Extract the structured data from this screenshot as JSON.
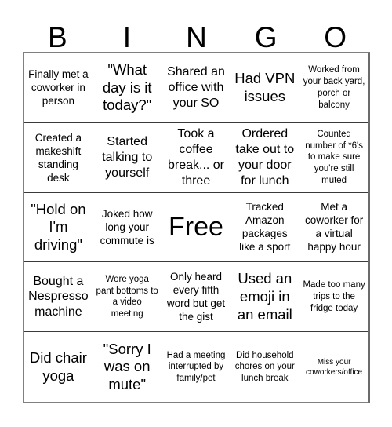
{
  "card": {
    "header_letters": [
      "B",
      "I",
      "N",
      "G",
      "O"
    ],
    "rows": [
      [
        {
          "text": "Finally met a coworker in person",
          "size": "md"
        },
        {
          "text": "\"What day is it today?\"",
          "size": "xl"
        },
        {
          "text": "Shared an office with your SO",
          "size": "lg"
        },
        {
          "text": "Had VPN issues",
          "size": "xl"
        },
        {
          "text": "Worked from your back yard, porch or balcony",
          "size": "sm"
        }
      ],
      [
        {
          "text": "Created a makeshift standing desk",
          "size": "md"
        },
        {
          "text": "Started talking to yourself",
          "size": "lg"
        },
        {
          "text": "Took a coffee break... or three",
          "size": "lg"
        },
        {
          "text": "Ordered take out to your door for lunch",
          "size": "lg"
        },
        {
          "text": "Counted number of *6's to make sure you're still muted",
          "size": "sm"
        }
      ],
      [
        {
          "text": "\"Hold on I'm driving\"",
          "size": "xl"
        },
        {
          "text": "Joked how long your commute is",
          "size": "md"
        },
        {
          "text": "Free",
          "size": "free"
        },
        {
          "text": "Tracked Amazon packages like a sport",
          "size": "md"
        },
        {
          "text": "Met a coworker for a virtual happy hour",
          "size": "md"
        }
      ],
      [
        {
          "text": "Bought a Nespresso machine",
          "size": "lg"
        },
        {
          "text": "Wore yoga pant bottoms to a video meeting",
          "size": "sm"
        },
        {
          "text": "Only heard every fifth word but get the gist",
          "size": "md"
        },
        {
          "text": "Used an emoji in an email",
          "size": "xl"
        },
        {
          "text": "Made too many trips to the fridge today",
          "size": "sm"
        }
      ],
      [
        {
          "text": "Did chair yoga",
          "size": "xl"
        },
        {
          "text": "\"Sorry I was on mute\"",
          "size": "xl"
        },
        {
          "text": "Had a meeting interrupted by family/pet",
          "size": "sm"
        },
        {
          "text": "Did household chores on your lunch break",
          "size": "sm"
        },
        {
          "text": "Miss your coworkers/office",
          "size": "xs"
        }
      ]
    ]
  }
}
